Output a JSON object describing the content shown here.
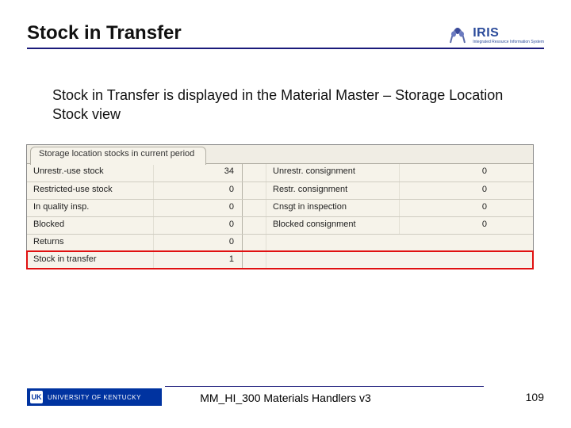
{
  "header": {
    "title": "Stock in Transfer",
    "iris_text": "IRIS",
    "iris_sub": "Integrated Resource Information System"
  },
  "body": {
    "text": "Stock in Transfer is displayed in the Material Master – Storage Location Stock view"
  },
  "panel": {
    "tab_label": "Storage location stocks in current period",
    "rows": [
      {
        "la": "Unrestr.-use stock",
        "va": "34",
        "lb": "Unrestr. consignment",
        "vb": "0"
      },
      {
        "la": "Restricted-use stock",
        "va": "0",
        "lb": "Restr. consignment",
        "vb": "0"
      },
      {
        "la": "In quality insp.",
        "va": "0",
        "lb": "Cnsgt in inspection",
        "vb": "0"
      },
      {
        "la": "Blocked",
        "va": "0",
        "lb": "Blocked consignment",
        "vb": "0"
      },
      {
        "la": "Returns",
        "va": "0",
        "lb": "",
        "vb": ""
      },
      {
        "la": "Stock in transfer",
        "va": "1",
        "lb": "",
        "vb": "",
        "highlight": true
      }
    ]
  },
  "footer": {
    "uk_label": "UNIVERSITY OF KENTUCKY",
    "uk_short": "UK",
    "center": "MM_HI_300 Materials Handlers v3",
    "page": "109"
  }
}
